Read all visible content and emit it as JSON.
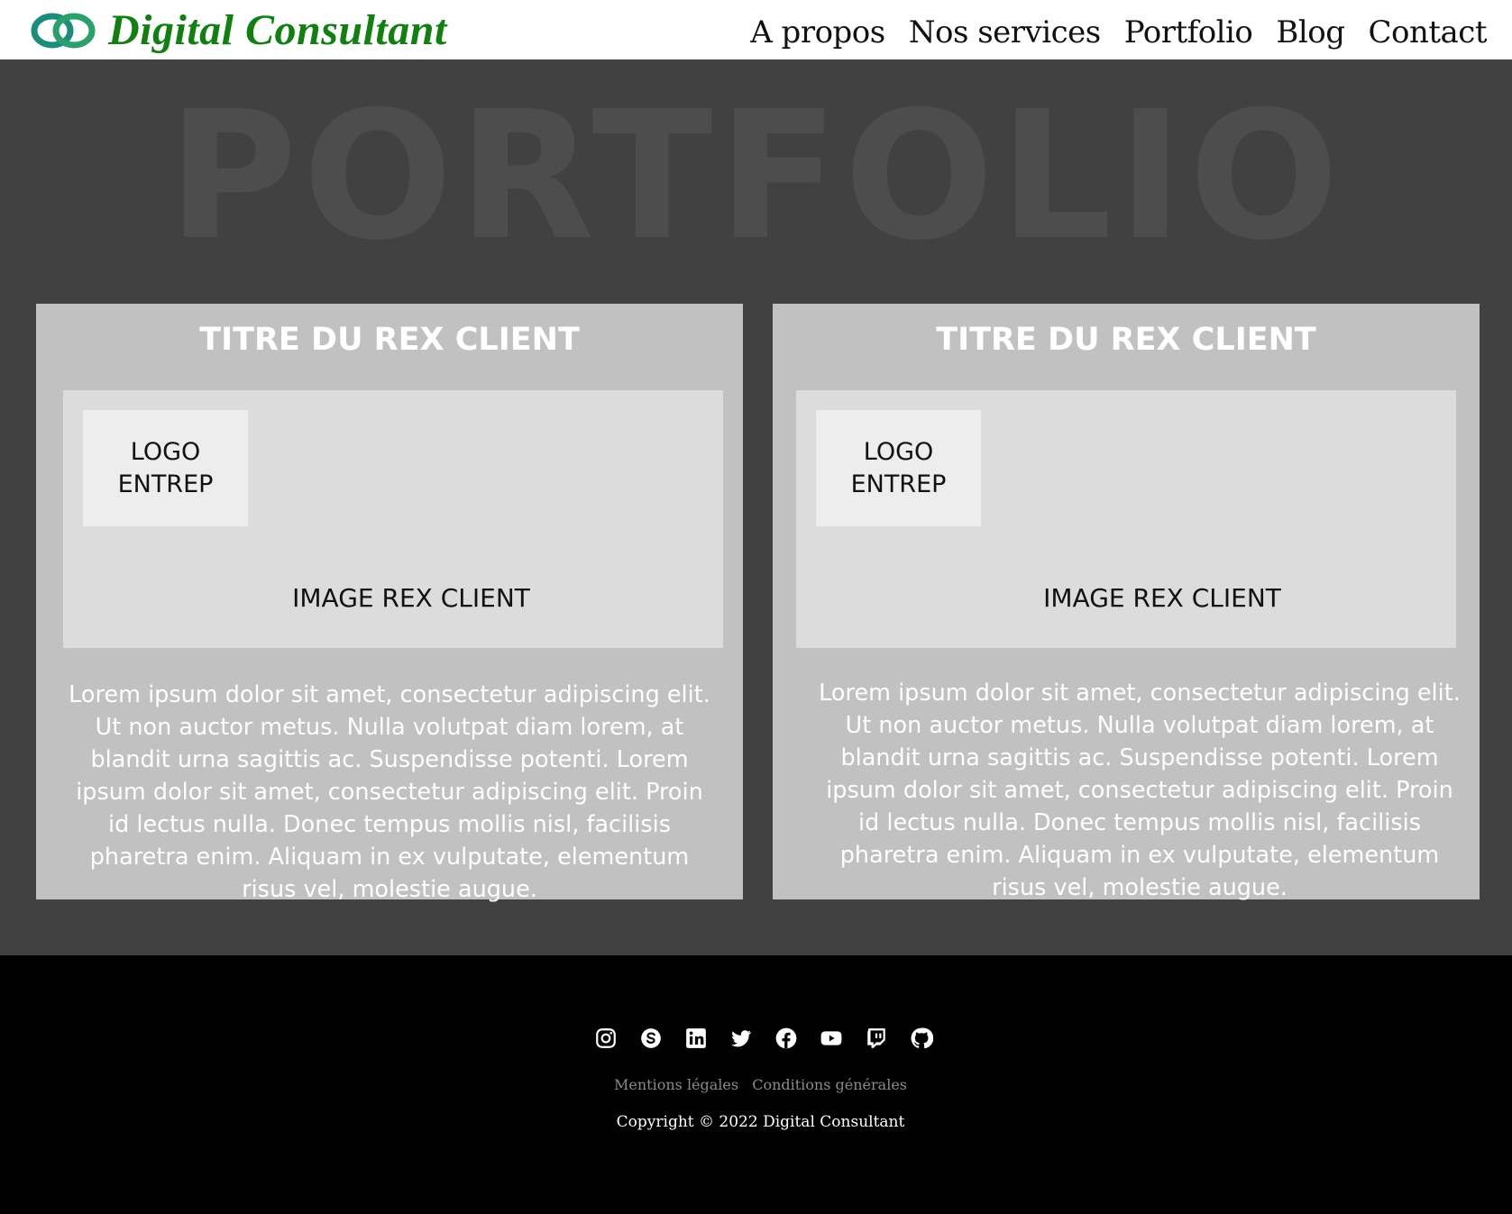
{
  "header": {
    "brand_name": "Digital Consultant",
    "nav": [
      "A propos",
      "Nos services",
      "Portfolio",
      "Blog",
      "Contact"
    ],
    "brand_colors": {
      "green": "#118011",
      "teal": "#1c8c7c"
    }
  },
  "main": {
    "hero_title": "PORTFOLIO",
    "cards": [
      {
        "title": "TITRE DU REX CLIENT",
        "logo_line1": "LOGO",
        "logo_line2": "ENTREP",
        "image_label": "IMAGE REX CLIENT",
        "text": "Lorem ipsum dolor sit amet, consectetur adipiscing elit. Ut non auctor metus. Nulla volutpat diam lorem, at blandit urna sagittis ac. Suspendisse potenti. Lorem ipsum dolor sit amet, consectetur adipiscing elit. Proin id lectus nulla. Donec tempus mollis nisl, facilisis pharetra enim. Aliquam in ex vulputate, elementum risus vel, molestie augue."
      },
      {
        "title": "TITRE DU REX CLIENT",
        "logo_line1": "LOGO",
        "logo_line2": "ENTREP",
        "image_label": "IMAGE REX CLIENT",
        "text": "Lorem ipsum dolor sit amet, consectetur adipiscing elit. Ut non auctor metus. Nulla volutpat diam lorem, at blandit urna sagittis ac. Suspendisse potenti. Lorem ipsum dolor sit amet, consectetur adipiscing elit. Proin id lectus nulla. Donec tempus mollis nisl, facilisis pharetra enim. Aliquam in ex vulputate, elementum risus vel, molestie augue."
      }
    ]
  },
  "footer": {
    "socials": [
      "instagram-icon",
      "skype-icon",
      "linkedin-icon",
      "twitter-icon",
      "facebook-icon",
      "youtube-icon",
      "twitch-icon",
      "github-icon"
    ],
    "legal_links": [
      "Mentions légales",
      "Conditions générales"
    ],
    "copyright": "Copyright © 2022 Digital Consultant"
  }
}
